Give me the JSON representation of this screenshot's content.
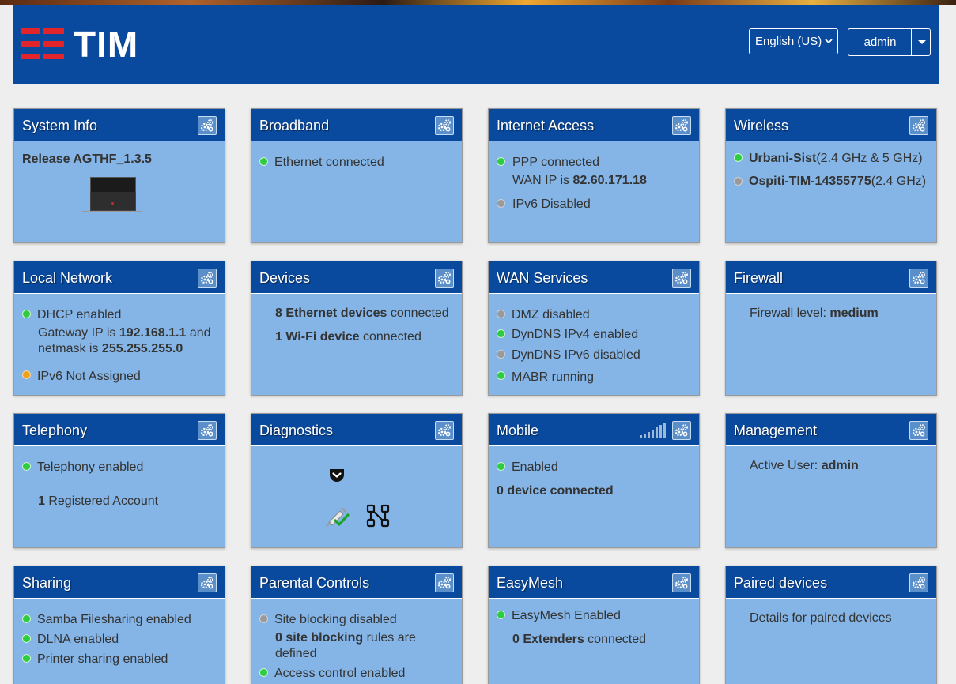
{
  "header": {
    "brand": "TIM",
    "language_select": "English (US)",
    "user_button": "admin"
  },
  "colors": {
    "header_bg": "#0a4a9e",
    "card_bg": "#84b5e6",
    "logo_red": "#e1252b",
    "status_green": "#2ecc40",
    "status_grey": "#9a9a9a",
    "status_orange": "#f0a020"
  },
  "cards": {
    "system_info": {
      "title": "System Info",
      "release": "Release AGTHF_1.3.5"
    },
    "broadband": {
      "title": "Broadband",
      "status": "Ethernet connected"
    },
    "internet_access": {
      "title": "Internet Access",
      "ppp": "PPP connected",
      "wan_prefix": "WAN IP is ",
      "wan_ip": "82.60.171.18",
      "ipv6": "IPv6 Disabled"
    },
    "wireless": {
      "title": "Wireless",
      "ssid1": "Urbani-Sist",
      "ssid1_band": "(2.4 GHz & 5 GHz)",
      "ssid2": "Ospiti-TIM-14355775",
      "ssid2_band": "(2.4 GHz)"
    },
    "local_network": {
      "title": "Local Network",
      "dhcp": "DHCP enabled",
      "gw_prefix": "Gateway IP is ",
      "gw_ip": "192.168.1.1",
      "gw_and": " and",
      "netmask_prefix": "netmask is ",
      "netmask": "255.255.255.0",
      "ipv6": "IPv6 Not Assigned"
    },
    "devices": {
      "title": "Devices",
      "eth_count": "8 Ethernet devices",
      "eth_suffix": " connected",
      "wifi_count": "1 Wi-Fi device",
      "wifi_suffix": " connected"
    },
    "wan_services": {
      "title": "WAN Services",
      "dmz": "DMZ disabled",
      "dyndns4": "DynDNS IPv4 enabled",
      "dyndns6": "DynDNS IPv6 disabled",
      "mabr": "MABR running"
    },
    "firewall": {
      "title": "Firewall",
      "level_prefix": "Firewall level: ",
      "level": "medium"
    },
    "telephony": {
      "title": "Telephony",
      "status": "Telephony enabled",
      "accounts_count": "1",
      "accounts_label": " Registered Account"
    },
    "diagnostics": {
      "title": "Diagnostics"
    },
    "mobile": {
      "title": "Mobile",
      "status": "Enabled",
      "devices": "0 device connected"
    },
    "management": {
      "title": "Management",
      "user_prefix": "Active User: ",
      "user": "admin"
    },
    "sharing": {
      "title": "Sharing",
      "samba": "Samba Filesharing enabled",
      "dlna": "DLNA enabled",
      "printer": "Printer sharing enabled"
    },
    "parental_controls": {
      "title": "Parental Controls",
      "site_blocking": "Site blocking disabled",
      "rules_count": "0 site blocking",
      "rules_suffix": " rules are",
      "rules_line2": "defined",
      "access_control": "Access control enabled"
    },
    "easymesh": {
      "title": "EasyMesh",
      "status": "EasyMesh Enabled",
      "extenders": "0 Extenders",
      "extenders_suffix": " connected"
    },
    "paired_devices": {
      "title": "Paired devices",
      "details": "Details for paired devices"
    }
  },
  "icons": {
    "card_settings": "gears-icon",
    "router": "router-image",
    "pocket": "pocket-icon",
    "network_check": "network-check-icon",
    "graph": "graph-nodes-icon",
    "signal": "signal-strength-icon"
  },
  "mobile_signal_bars_lit": 0
}
